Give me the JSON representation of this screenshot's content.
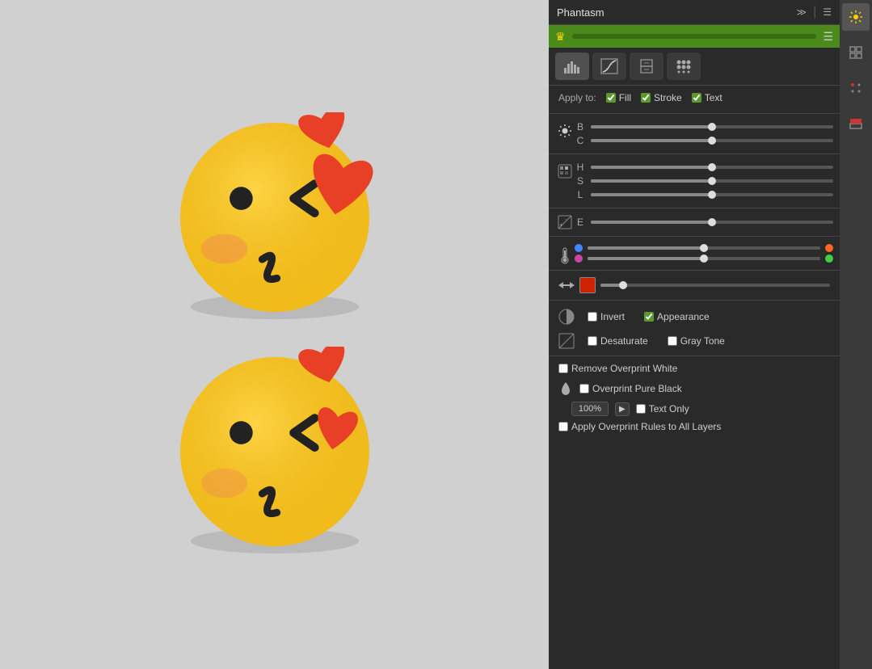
{
  "panel": {
    "title": "Phantasm",
    "menu_label": "≫",
    "settings_label": "☰",
    "green_banner": {
      "icon": "♛",
      "menu": "☰"
    },
    "tabs": [
      {
        "label": "histogram",
        "active": true
      },
      {
        "label": "curves"
      },
      {
        "label": "layers"
      },
      {
        "label": "halftone"
      }
    ],
    "apply_to": {
      "label": "Apply to:",
      "fill": {
        "label": "Fill",
        "checked": true
      },
      "stroke": {
        "label": "Stroke",
        "checked": true
      },
      "text": {
        "label": "Text",
        "checked": true
      }
    },
    "sliders": {
      "B": {
        "value": 50
      },
      "C": {
        "value": 50
      },
      "H": {
        "value": 50
      },
      "S": {
        "value": 50
      },
      "L": {
        "value": 50
      },
      "E": {
        "value": 50
      }
    },
    "temperature": {
      "warm": {
        "value": 50
      },
      "tint": {
        "value": 50
      }
    },
    "color_slider": {
      "swatch": "red"
    },
    "invert": {
      "label": "Invert",
      "checked": false,
      "appearance_label": "Appearance",
      "appearance_checked": true
    },
    "desaturate": {
      "label": "Desaturate",
      "checked": false,
      "gray_tone_label": "Gray Tone",
      "gray_tone_checked": false
    },
    "remove_overprint": {
      "label": "Remove Overprint White",
      "checked": false
    },
    "overprint_pure_black": {
      "label": "Overprint Pure Black",
      "checked": false
    },
    "text_only": {
      "percent": "100%",
      "label": "Text Only",
      "checked": false
    },
    "apply_all_layers": {
      "label": "Apply Overprint Rules to All Layers",
      "checked": false
    }
  }
}
